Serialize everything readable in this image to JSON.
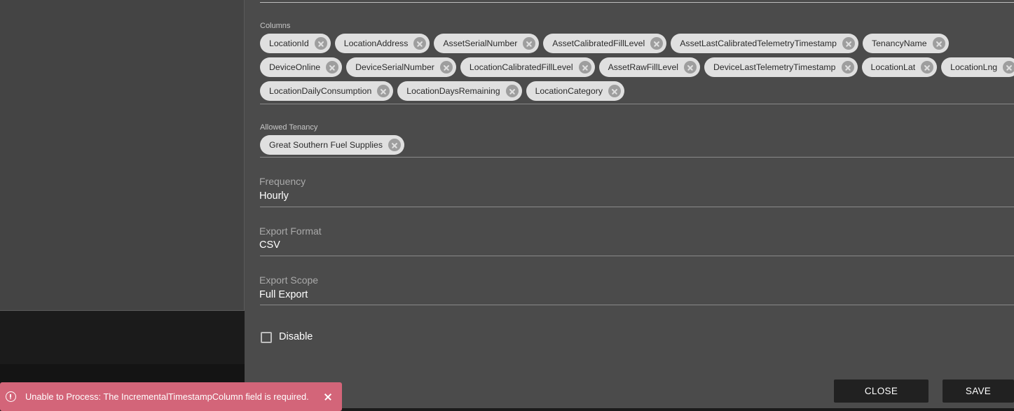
{
  "columns": {
    "label": "Columns",
    "rows": [
      [
        "LocationId",
        "LocationAddress",
        "AssetSerialNumber",
        "AssetCalibratedFillLevel",
        "AssetLastCalibratedTelemetryTimestamp",
        "TenancyName"
      ],
      [
        "DeviceOnline",
        "DeviceSerialNumber",
        "LocationCalibratedFillLevel",
        "AssetRawFillLevel",
        "DeviceLastTelemetryTimestamp",
        "LocationLat",
        "LocationLng"
      ],
      [
        "LocationDailyConsumption",
        "LocationDaysRemaining",
        "LocationCategory"
      ]
    ]
  },
  "allowed_tenancy": {
    "label": "Allowed Tenancy",
    "chips": [
      "Great Southern Fuel Supplies"
    ]
  },
  "frequency": {
    "label": "Frequency",
    "value": "Hourly"
  },
  "export_format": {
    "label": "Export Format",
    "value": "CSV"
  },
  "export_scope": {
    "label": "Export Scope",
    "value": "Full Export"
  },
  "disable": {
    "label": "Disable",
    "checked": false
  },
  "buttons": {
    "close": "CLOSE",
    "save": "SAVE"
  },
  "toast": {
    "icon": "error-icon",
    "message": "Unable to Process: The IncrementalTimestampColumn field is required.",
    "color": "#d36579"
  }
}
